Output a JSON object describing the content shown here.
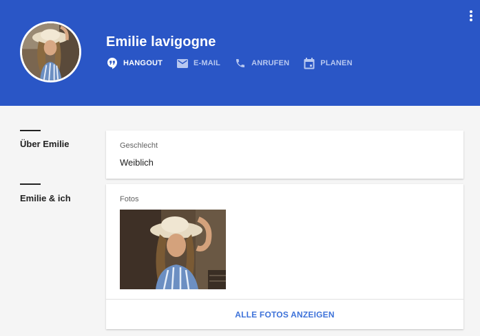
{
  "profile": {
    "name": "Emilie lavigogne",
    "actions": [
      {
        "icon": "hangout-icon",
        "label": "HANGOUT"
      },
      {
        "icon": "email-icon",
        "label": "E-MAIL"
      },
      {
        "icon": "phone-icon",
        "label": "ANRUFEN"
      },
      {
        "icon": "calendar-icon",
        "label": "PLANEN"
      }
    ]
  },
  "sections": {
    "about_label": "Über Emilie",
    "relation_label": "Emilie & ich"
  },
  "gender_card": {
    "label": "Geschlecht",
    "value": "Weiblich"
  },
  "photos_card": {
    "label": "Fotos",
    "show_all": "ALLE FOTOS ANZEIGEN"
  },
  "colors": {
    "header": "#2a56c6",
    "link": "#3d72d9"
  }
}
